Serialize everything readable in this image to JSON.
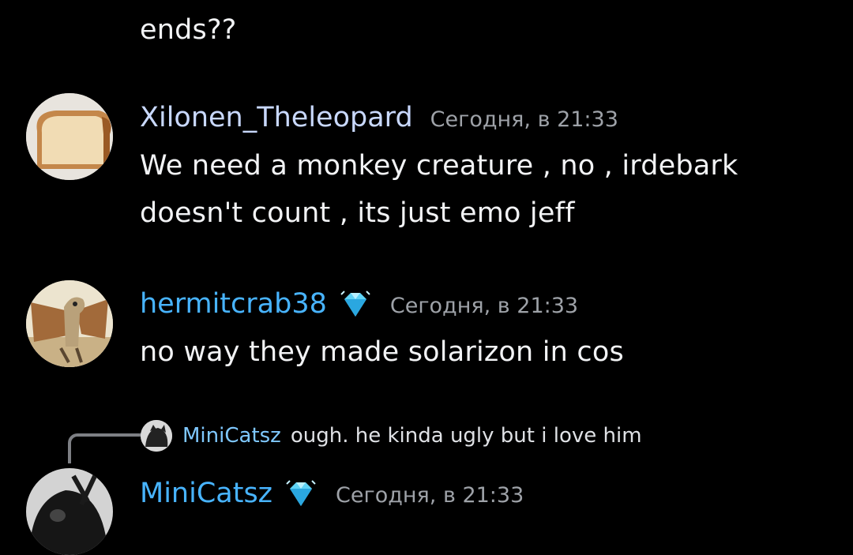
{
  "colors": {
    "background": "#000000",
    "username_light": "#c9d9ff",
    "username_blue": "#48b4ff",
    "timestamp": "#9ea2a8",
    "text": "#f2f3f5"
  },
  "top_fragment": {
    "text": "ends??"
  },
  "messages": [
    {
      "username": "Xilonen_Theleopard",
      "timestamp": "Сегодня, в 21:33",
      "avatar_icon": "bread-slice-avatar",
      "lines": [
        "We need a monkey creature , no , irdebark",
        "doesn't count , its just emo jeff"
      ]
    },
    {
      "username": "hermitcrab38",
      "badge_icon": "diamond-badge-icon",
      "timestamp": "Сегодня, в 21:33",
      "avatar_icon": "creature-drawing-avatar",
      "lines": [
        "no way they made solarizon in cos"
      ]
    },
    {
      "username": "MiniCatsz",
      "badge_icon": "diamond-badge-icon",
      "timestamp": "Сегодня, в 21:33",
      "avatar_icon": "dark-cat-avatar",
      "reply": {
        "username": "MiniCatsz",
        "text": "ough. he kinda ugly but i love him"
      }
    }
  ]
}
